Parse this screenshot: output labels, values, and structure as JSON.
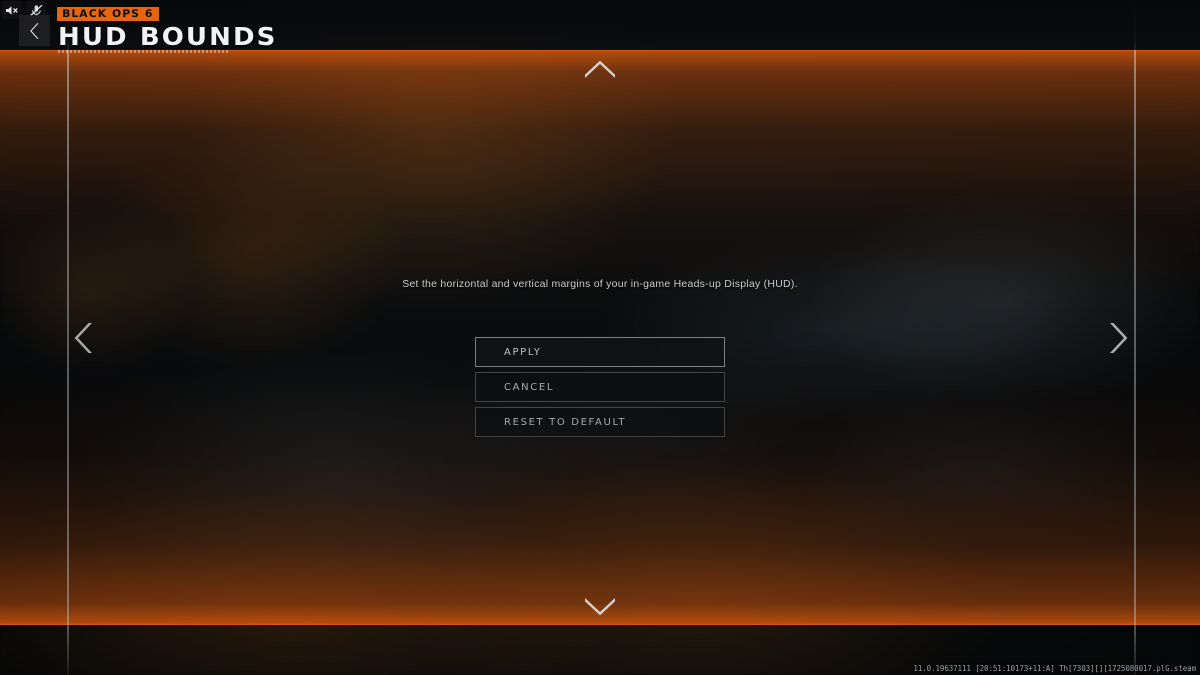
{
  "header": {
    "game_badge": "BLACK OPS 6",
    "page_title": "HUD BOUNDS",
    "back_icon": "chevron-left-icon",
    "mute_audio_icon": "speaker-muted-icon",
    "mute_mic_icon": "microphone-muted-icon"
  },
  "main": {
    "description": "Set the horizontal and vertical margins of your in-game Heads-up Display (HUD).",
    "buttons": [
      {
        "label": "APPLY",
        "name": "apply-button",
        "focused": true
      },
      {
        "label": "CANCEL",
        "name": "cancel-button",
        "focused": false
      },
      {
        "label": "RESET TO DEFAULT",
        "name": "reset-to-default-button",
        "focused": false
      }
    ]
  },
  "adjusters": {
    "left_arrow_icon": "chevron-left-icon",
    "right_arrow_icon": "chevron-right-icon",
    "up_arrow_icon": "chevron-up-icon",
    "down_arrow_icon": "chevron-down-icon"
  },
  "footer": {
    "build_string": "11.0.19637111 [20:51:10173+11:A] Th[7303][][1725080017.plG.steam"
  },
  "colors": {
    "accent_orange": "#e8640f",
    "bound_bar_orange": "#f0600a",
    "guide_line": "#ced4d8",
    "button_text": "#a7abae",
    "background_dark": "#07090b"
  }
}
